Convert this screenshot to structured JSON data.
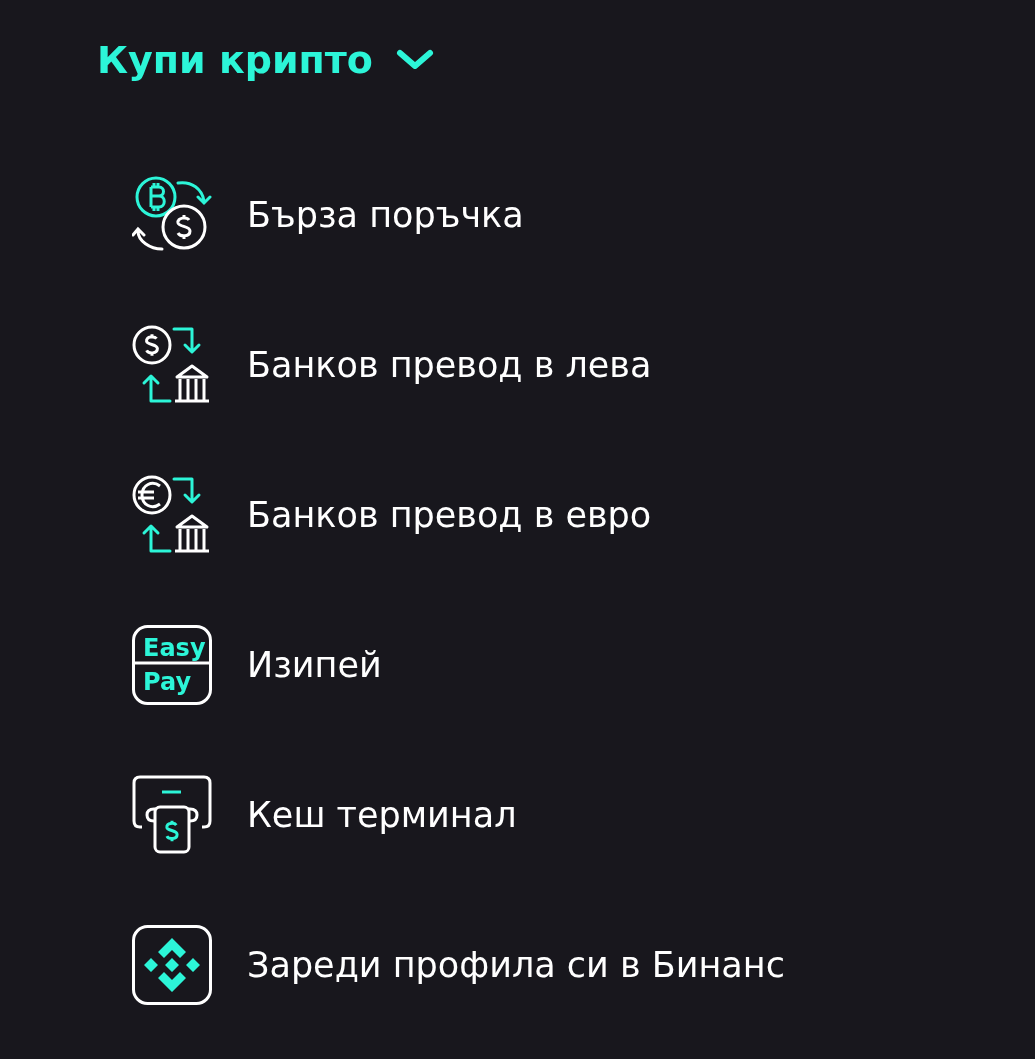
{
  "menu": {
    "title": "Купи крипто",
    "expanded": true,
    "items": [
      {
        "kind": "crypto-exchange",
        "label": "Бърза поръчка"
      },
      {
        "kind": "bank-dollar",
        "label": "Банков превод в лева"
      },
      {
        "kind": "bank-euro",
        "label": "Банков превод в евро"
      },
      {
        "kind": "easypay",
        "label": "Изипей",
        "icon_text": [
          "Easy",
          "Pay"
        ]
      },
      {
        "kind": "cash-terminal",
        "label": "Кеш терминал"
      },
      {
        "kind": "binance",
        "label": "Зареди профила си в Бинанс"
      }
    ]
  }
}
